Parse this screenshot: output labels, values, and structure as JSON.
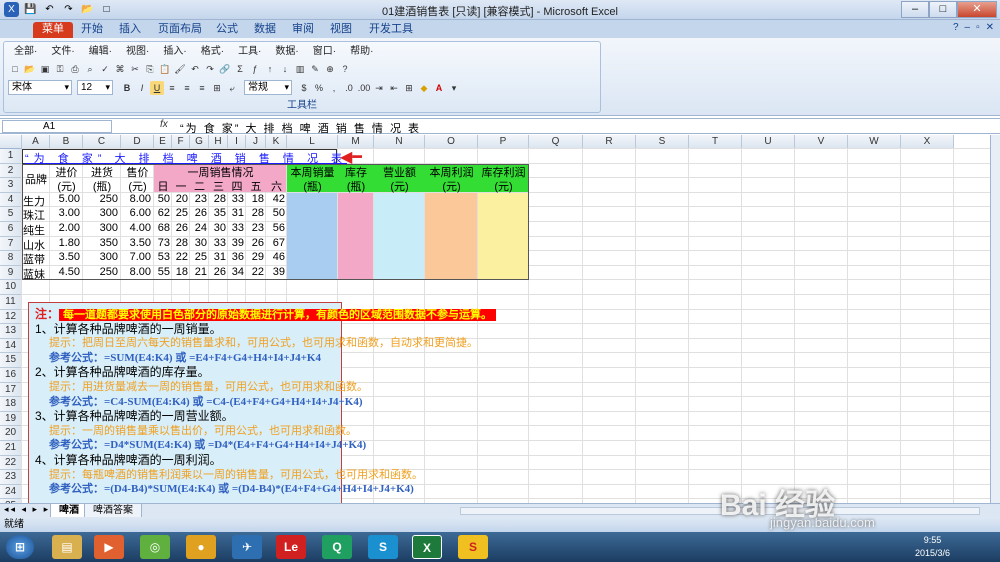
{
  "window": {
    "title": "01建酒销售表 [只读] [兼容模式] - Microsoft Excel"
  },
  "ribbon_tabs": [
    "菜单",
    "开始",
    "插入",
    "页面布局",
    "公式",
    "数据",
    "审阅",
    "视图",
    "开发工具"
  ],
  "menu_items": [
    "全部·",
    "文件·",
    "编辑·",
    "视图·",
    "插入·",
    "格式·",
    "工具·",
    "数据·",
    "窗口·",
    "帮助·"
  ],
  "toolbar": {
    "font": "宋体",
    "size": "12",
    "number_format": "常规",
    "group_label": "工具栏",
    "bold": "B",
    "italic": "I",
    "underline": "U"
  },
  "formula_bar": {
    "name_box": "A1",
    "fx": "fx",
    "content": "“为 食 家” 大 排 档 啤 酒 销 售 情 况 表"
  },
  "columns": [
    "A",
    "B",
    "C",
    "D",
    "E",
    "F",
    "G",
    "H",
    "I",
    "J",
    "K",
    "L",
    "M",
    "N",
    "O",
    "P",
    "Q",
    "R",
    "S",
    "T",
    "U",
    "V",
    "W",
    "X"
  ],
  "rows": [
    "1",
    "2",
    "3",
    "4",
    "5",
    "6",
    "7",
    "8",
    "9",
    "10",
    "11",
    "12",
    "13",
    "14",
    "15",
    "16",
    "17",
    "18",
    "19",
    "20",
    "21",
    "22",
    "23",
    "24",
    "25"
  ],
  "sheet": {
    "title": "“为 食 家” 大 排 档 啤 酒 销 售 情 况 表",
    "headers": {
      "brand": "品牌",
      "cost": "进价",
      "cost_unit": "(元)",
      "stock_in": "进货",
      "stock_in_unit": "(瓶)",
      "price": "售价",
      "price_unit": "(元)",
      "week_sales": "一周销售情况",
      "days": [
        "日",
        "一",
        "二",
        "三",
        "四",
        "五",
        "六"
      ],
      "weekly_qty": "本周销量",
      "weekly_qty_unit": "(瓶)",
      "inventory": "库存",
      "inventory_unit": "(瓶)",
      "revenue": "营业额",
      "revenue_unit": "(元)",
      "profit": "本周利润",
      "profit_unit": "(元)",
      "inv_profit": "库存利润",
      "inv_profit_unit": "(元)"
    },
    "data": [
      {
        "brand": "生力",
        "cost": "5.00",
        "stock": "250",
        "price": "8.00",
        "days": [
          "50",
          "20",
          "23",
          "28",
          "33",
          "18",
          "42"
        ]
      },
      {
        "brand": "珠江",
        "cost": "3.00",
        "stock": "300",
        "price": "6.00",
        "days": [
          "62",
          "25",
          "26",
          "35",
          "31",
          "28",
          "50"
        ]
      },
      {
        "brand": "纯生",
        "cost": "2.00",
        "stock": "300",
        "price": "4.00",
        "days": [
          "68",
          "26",
          "24",
          "30",
          "33",
          "23",
          "56"
        ]
      },
      {
        "brand": "山水",
        "cost": "1.80",
        "stock": "350",
        "price": "3.50",
        "days": [
          "73",
          "28",
          "30",
          "33",
          "39",
          "26",
          "67"
        ]
      },
      {
        "brand": "蓝带",
        "cost": "3.50",
        "stock": "300",
        "price": "7.00",
        "days": [
          "53",
          "22",
          "25",
          "31",
          "36",
          "29",
          "46"
        ]
      },
      {
        "brand": "蓝妹",
        "cost": "4.50",
        "stock": "250",
        "price": "8.00",
        "days": [
          "55",
          "18",
          "21",
          "26",
          "34",
          "22",
          "39"
        ]
      }
    ]
  },
  "notes": {
    "heading_prefix": "注：",
    "heading": "每一道题都要求使用白色部分的原始数据进行计算，有颜色的区域范围数据不参与运算。",
    "lines": [
      {
        "type": "q",
        "text": "1、计算各种品牌啤酒的一周销量。"
      },
      {
        "type": "hint",
        "text": "提示：把周日至周六每天的销售量求和，可用公式，也可用求和函数，自动求和更简捷。"
      },
      {
        "type": "ref",
        "text": "参考公式：=SUM(E4:K4)    或    =E4+F4+G4+H4+I4+J4+K4"
      },
      {
        "type": "q",
        "text": "2、计算各种品牌啤酒的库存量。"
      },
      {
        "type": "hint",
        "text": "提示：用进货量减去一周的销售量，可用公式，也可用求和函数。"
      },
      {
        "type": "ref",
        "text": "参考公式：=C4-SUM(E4:K4)    或    =C4-(E4+F4+G4+H4+I4+J4+K4)"
      },
      {
        "type": "q",
        "text": "3、计算各种品牌啤酒的一周营业额。"
      },
      {
        "type": "hint",
        "text": "提示：一周的销售量乘以售出价，可用公式，也可用求和函数。"
      },
      {
        "type": "ref",
        "text": "参考公式：=D4*SUM(E4:K4)    或    =D4*(E4+F4+G4+H4+I4+J4+K4)"
      },
      {
        "type": "q",
        "text": "4、计算各种品牌啤酒的一周利润。"
      },
      {
        "type": "hint",
        "text": "提示：每瓶啤酒的销售利润乘以一周的销售量，可用公式，也可用求和函数。"
      },
      {
        "type": "ref",
        "text": "参考公式：=(D4-B4)*SUM(E4:K4)    或    =(D4-B4)*(E4+F4+G4+H4+I4+J4+K4)"
      }
    ]
  },
  "sheet_tabs": [
    "啤酒",
    "啤酒答案"
  ],
  "status": {
    "text": "就绪"
  },
  "taskbar": {
    "time": "9:55",
    "date": "2015/3/6",
    "watermark": "Bai 经验",
    "watermark_url": "jingyan.baidu.com"
  },
  "colors": {
    "pink": "#f4a8c8",
    "blue": "#a8cdf0",
    "lightblue": "#c8ecf8",
    "orange": "#fbc89a",
    "yellow": "#fbf0a0",
    "green": "#33dd33",
    "red": "#ff0000"
  }
}
